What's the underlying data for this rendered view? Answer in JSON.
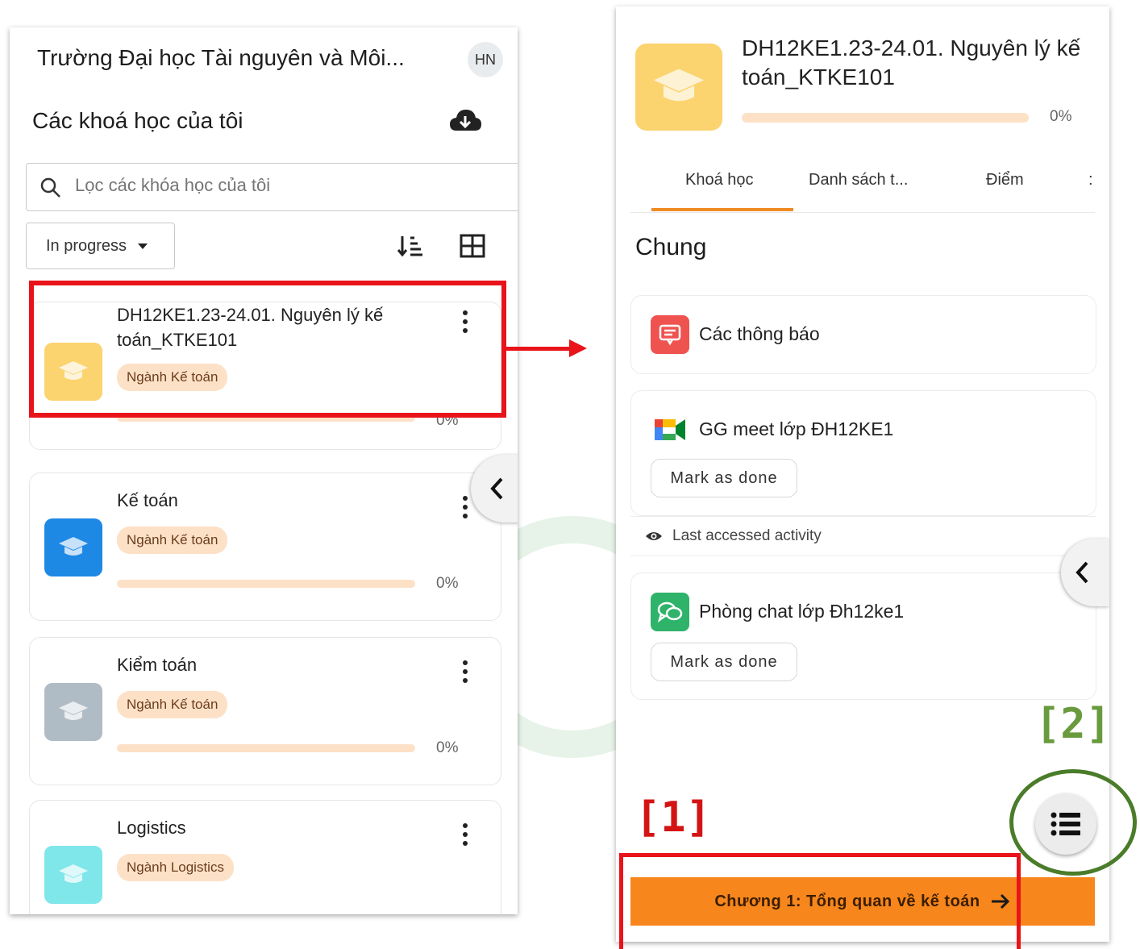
{
  "left_screen": {
    "site_title": "Trường Đại học Tài nguyên và Môi...",
    "avatar": "HN",
    "page_title": "Các khoá học của tôi",
    "search": {
      "placeholder": "Lọc các khóa học của tôi"
    },
    "filter": {
      "selected": "In progress"
    },
    "courses": [
      {
        "name": "DH12KE1.23-24.01. Nguyên lý kế toán_KTKE101",
        "tag": "Ngành Kế toán",
        "progress": "0%",
        "progress_value": 0,
        "thumb_color": "#fbd36f"
      },
      {
        "name": "Kế toán",
        "tag": "Ngành Kế toán",
        "progress": "0%",
        "progress_value": 0,
        "thumb_color": "#1e88e5"
      },
      {
        "name": "Kiểm toán",
        "tag": "Ngành Kế toán",
        "progress": "0%",
        "progress_value": 0,
        "thumb_color": "#b0bcc5"
      },
      {
        "name": "Logistics",
        "tag": "Ngành Logistics",
        "progress": "",
        "progress_value": 0,
        "thumb_color": "#7fe6ea"
      }
    ],
    "icons": [
      "cloud-download-icon",
      "search-icon",
      "sort-icon",
      "grid-view-icon",
      "kebab-menu-icon",
      "chevron-left-icon",
      "graduation-cap-icon"
    ]
  },
  "right_screen": {
    "course_title": "DH12KE1.23-24.01. Nguyên lý kế toán_KTKE101",
    "progress": "0%",
    "tabs": [
      {
        "label": "Khoá học",
        "active": true
      },
      {
        "label": "Danh sách t...",
        "active": false
      },
      {
        "label": "Điểm",
        "active": false
      }
    ],
    "tab_more": ":",
    "section_title": "Chung",
    "activities": [
      {
        "name": "Các thông báo",
        "icon": "announcement-icon",
        "color": "#ef5350"
      },
      {
        "name": "GG meet lớp ĐH12KE1",
        "icon": "google-meet-icon",
        "button": "Mark as done"
      },
      {
        "name": "Phòng chat lớp Đh12ke1",
        "icon": "chat-icon",
        "color": "#2fb36b",
        "button": "Mark as done"
      }
    ],
    "last_accessed": "Last accessed activity",
    "next_button": "Chương 1: Tổng quan về kế toán"
  },
  "annotations": {
    "label_1": "[1]",
    "label_2": "[2]",
    "colors": {
      "red": "#e8141a",
      "green": "#4a7c2a"
    }
  }
}
